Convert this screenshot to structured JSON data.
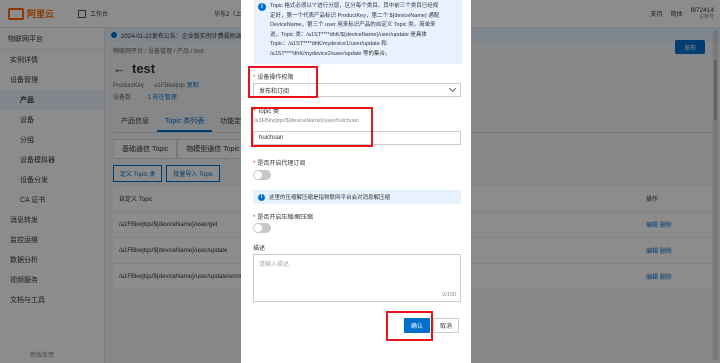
{
  "topbar": {
    "logo": "阿里云",
    "tabs": [
      "工作台",
      "",
      "华东2（上海）"
    ],
    "right": [
      "支持",
      "简体"
    ],
    "account_name": "f872414",
    "account_sub": "主账号"
  },
  "sidebar": {
    "header": "物联网平台",
    "items": [
      {
        "label": "实例详情"
      },
      {
        "label": "设备管理"
      },
      {
        "label": "产品"
      },
      {
        "label": "设备"
      },
      {
        "label": "分组"
      },
      {
        "label": "设备模拟器"
      },
      {
        "label": "设备分发"
      },
      {
        "label": "CA 证书"
      },
      {
        "label": "消息转发"
      },
      {
        "label": "监控运维"
      },
      {
        "label": "数据分析"
      },
      {
        "label": "视频服务"
      },
      {
        "label": "文档与工具"
      }
    ],
    "feedback": "新版反馈"
  },
  "main": {
    "notice": "2024-01-22发布公告：企业版实例计费规则调整",
    "breadcrumb": "物联网平台 / 设备管理 / 产品 / test",
    "title": "test",
    "publish": "发布",
    "product_key_label": "ProductKey",
    "product_key": "a1FBkwjtqs",
    "copy": "复制",
    "device_count_label": "设备数",
    "device_count": "1",
    "device_manage": "前往管理",
    "view": "查看",
    "tabs": [
      "产品信息",
      "Topic 类列表",
      "功能定义"
    ],
    "subtabs": [
      "基础通信 Topic",
      "物模型通信 Topic"
    ],
    "buttons": [
      "定义 Topic 类",
      "批量导入 Topic"
    ],
    "table_header": [
      "自定义 Topic",
      "操作"
    ],
    "rows": [
      {
        "topic": "/a1FBkwjtqs/${deviceName}/user/get",
        "edit": "编辑",
        "del": "删除"
      },
      {
        "topic": "/a1FBkwjtqs/${deviceName}/user/update",
        "edit": "编辑",
        "del": "删除"
      },
      {
        "topic": "/a1FBkwjtqs/${deviceName}/user/update/error",
        "edit": "编辑",
        "del": "删除"
      }
    ]
  },
  "dialog": {
    "tip_lines": [
      "Topic 格式必须以\"/\"进行分层，区分每个类目。其中前三个类目已经规",
      "定好，第一个代表产品标识 ProductKey，第二个 ${deviceName} 通配",
      "DeviceName，第三个 user 用来标识产品的自定义 Topic 类。简单来",
      "说，Topic 类：/a1ST****dhK/${deviceName}/user/update 是具体",
      "Topic：/a1ST****dhK/mydevice1/user/update 和",
      "/a1ST****dhK/mydevice2/user/update 等的集合。"
    ],
    "permission_label": "设备操作权限",
    "permission_value": "发布和订阅",
    "topic_label": "Topic 类",
    "topic_prefix": "/a1FBkwjtqs/${deviceName}/user/huichuan",
    "topic_value": "huichuan",
    "proxy_label": "是否开启代理订阅",
    "compress_note": "这里的压缩解压缩是指物联网平台会对消息解压缩",
    "compress_label": "是否开启压缩/解压缩",
    "desc_label": "描述",
    "desc_placeholder": "请输入描述",
    "desc_counter": "0/100",
    "ok": "确认",
    "cancel": "取消"
  }
}
